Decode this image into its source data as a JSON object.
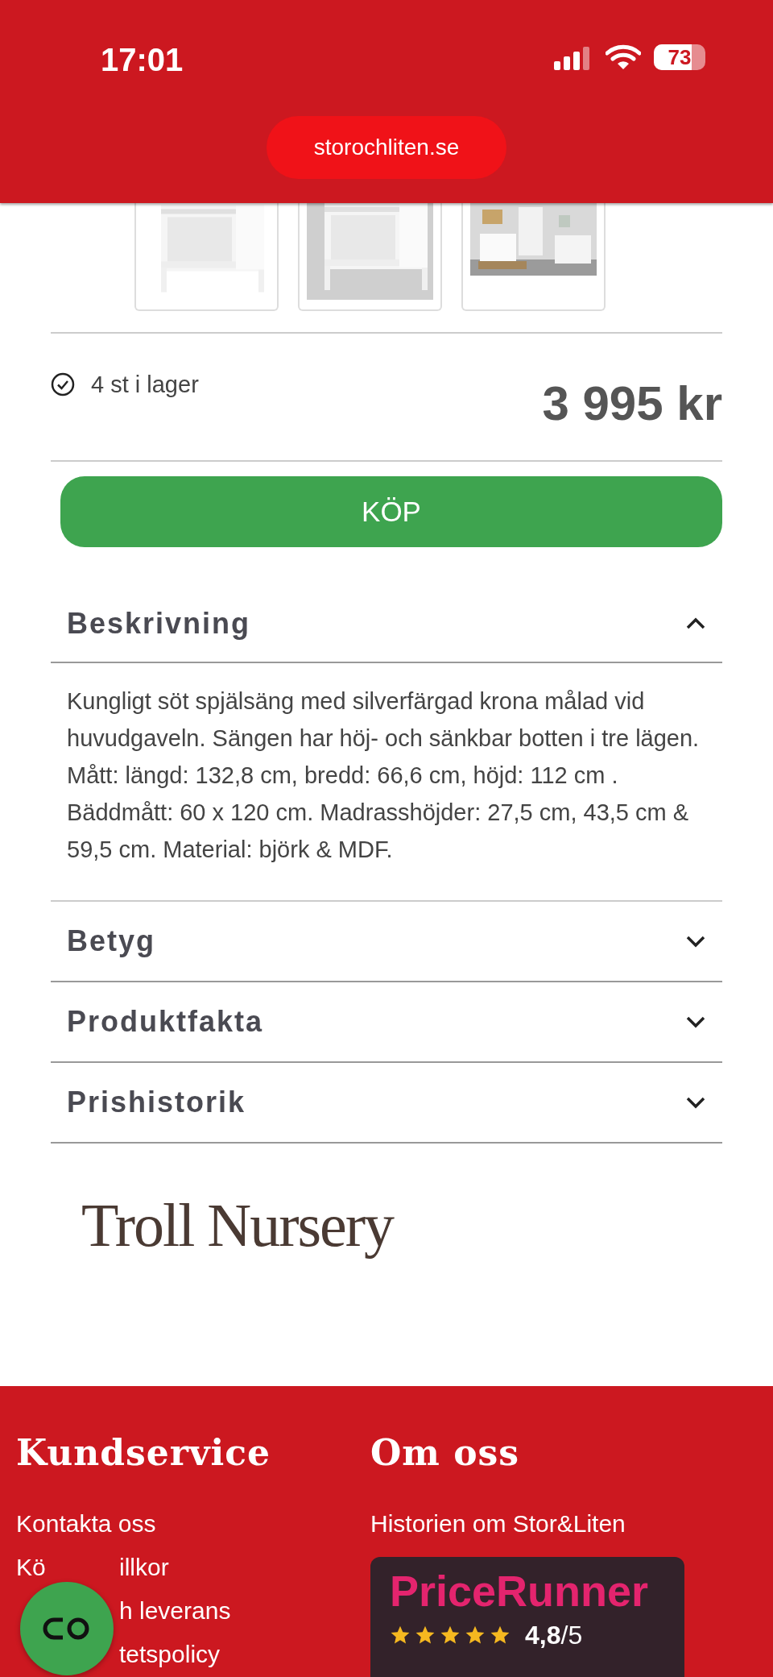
{
  "status_bar": {
    "time": "17:01",
    "battery": "73"
  },
  "address_bar": {
    "url": "storochliten.se"
  },
  "stock": {
    "text": "4 st i lager"
  },
  "price": "3 995 kr",
  "buy_button": "KÖP",
  "sections": [
    {
      "title": "Beskrivning",
      "expanded": true,
      "body": "Kungligt söt spjälsäng med silverfärgad krona målad vid huvudgaveln. Sängen har höj- och sänkbar botten i tre lägen. Mått: längd: 132,8 cm, bredd: 66,6 cm, höjd: 112 cm . Bäddmått: 60 x 120 cm. Madrasshöjder: 27,5 cm, 43,5 cm & 59,5 cm. Material: björk & MDF."
    },
    {
      "title": "Betyg",
      "expanded": false
    },
    {
      "title": "Produktfakta",
      "expanded": false
    },
    {
      "title": "Prishistorik",
      "expanded": false
    }
  ],
  "brand_logo": "Troll Nursery",
  "footer": {
    "columns": [
      {
        "heading": "Kundservice",
        "links": [
          {
            "text": "Kontakta oss"
          },
          {
            "before": "Kö",
            "text": "illkor"
          },
          {
            "text": "h leverans"
          },
          {
            "text": "tetspolicy"
          }
        ]
      },
      {
        "heading": "Om oss",
        "links": [
          {
            "text": "Historien om Stor&Liten"
          }
        ]
      }
    ],
    "pricerunner": {
      "logo": "PriceRunner",
      "stars": 5,
      "rating": "**4,8**/5"
    }
  }
}
